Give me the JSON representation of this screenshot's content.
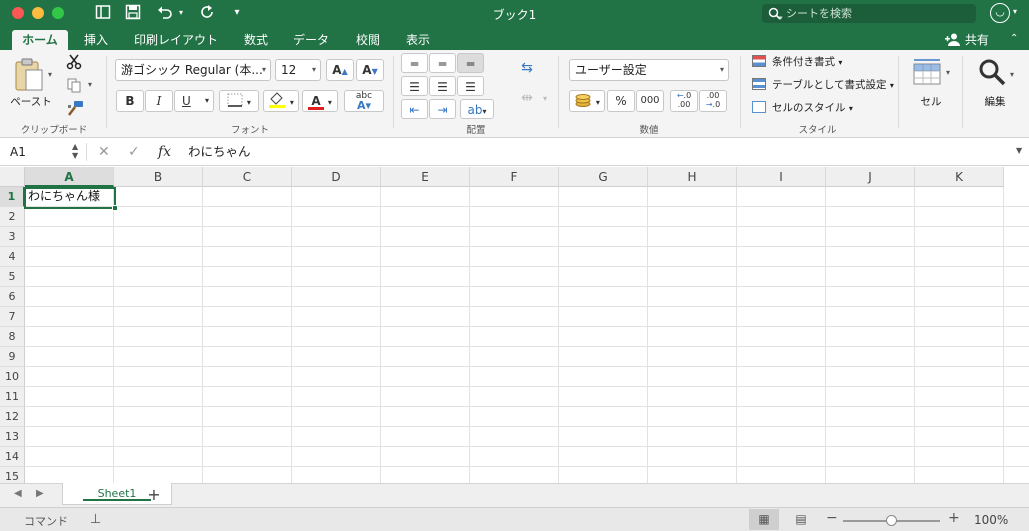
{
  "app": {
    "title": "ブック1",
    "search_placeholder": "シートを検索",
    "accent_color": "#217346"
  },
  "quick_access": {
    "icons": [
      "sidebar-icon",
      "save-icon",
      "undo-icon",
      "redo-icon",
      "customize-icon"
    ]
  },
  "tabs": [
    {
      "label": "ホーム",
      "active": true
    },
    {
      "label": "挿入"
    },
    {
      "label": "印刷レイアウト"
    },
    {
      "label": "数式"
    },
    {
      "label": "データ"
    },
    {
      "label": "校閲"
    },
    {
      "label": "表示"
    }
  ],
  "share_label": "共有",
  "ribbon": {
    "clipboard": {
      "group_label": "クリップボード",
      "paste_label": "ペースト"
    },
    "font": {
      "group_label": "フォント",
      "font_name": "游ゴシック Regular (本...",
      "font_size": "12",
      "bold": "B",
      "italic": "I",
      "underline": "U",
      "grow": "A",
      "shrink": "A",
      "color_letter": "A",
      "phonetic": "abc",
      "highlight_color": "#ffff00",
      "font_color": "#e02020"
    },
    "alignment": {
      "group_label": "配置"
    },
    "number": {
      "group_label": "数値",
      "format": "ユーザー設定",
      "percent": "%",
      "comma": "000",
      "inc_decimal": ".00",
      "dec_decimal": ".0"
    },
    "styles": {
      "group_label": "スタイル",
      "conditional": "条件付き書式",
      "as_table": "テーブルとして書式設定",
      "cell_styles": "セルのスタイル"
    },
    "cells": {
      "label": "セル"
    },
    "editing": {
      "label": "編集"
    }
  },
  "formula_bar": {
    "name_box": "A1",
    "fx": "fx",
    "content": "わにちゃん"
  },
  "grid": {
    "columns": [
      "A",
      "B",
      "C",
      "D",
      "E",
      "F",
      "G",
      "H",
      "I",
      "J",
      "K"
    ],
    "rows": [
      "1",
      "2",
      "3",
      "4",
      "5",
      "6",
      "7",
      "8",
      "9",
      "10",
      "11",
      "12",
      "13",
      "14",
      "15"
    ],
    "selected_cell": "A1",
    "cells": {
      "A1": "わにちゃん様"
    }
  },
  "sheets": [
    {
      "name": "Sheet1",
      "active": true
    }
  ],
  "add_sheet": "+",
  "status": {
    "mode": "コマンド",
    "zoom_minus": "−",
    "zoom_plus": "+",
    "zoom": "100%",
    "zoom_fraction": 0.5
  }
}
